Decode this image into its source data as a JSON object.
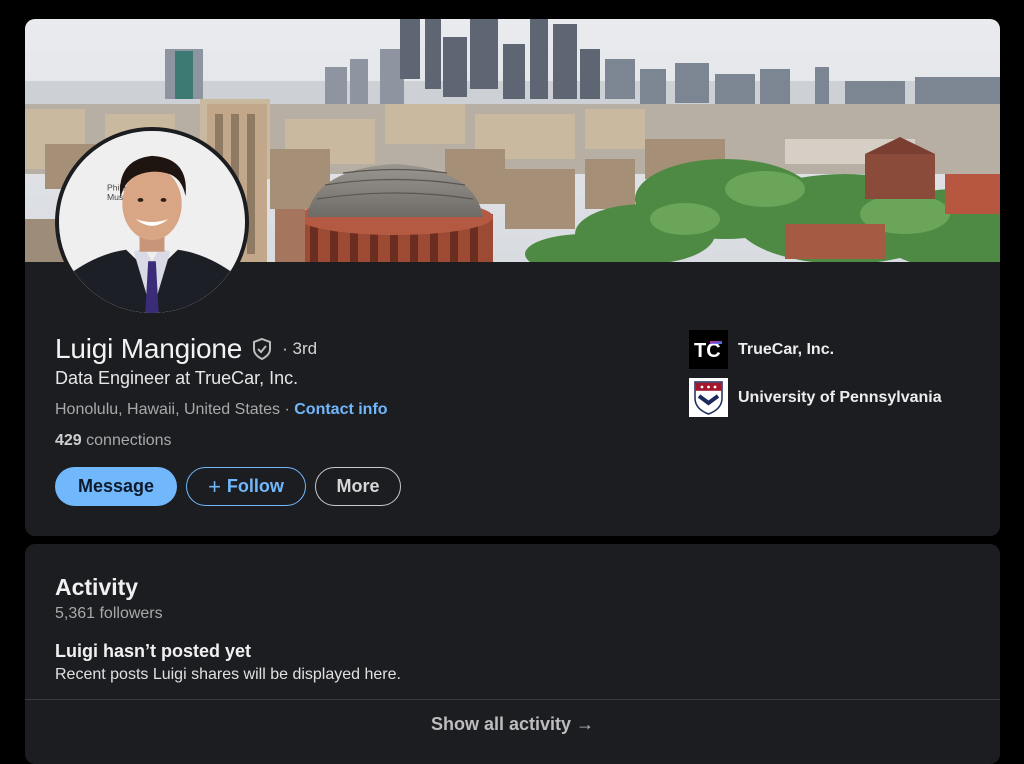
{
  "profile": {
    "name": "Luigi Mangione",
    "degree": "· 3rd",
    "headline": "Data Engineer at TrueCar, Inc.",
    "location": "Honolulu, Hawaii, United States",
    "separator": " · ",
    "contact_label": "Contact info",
    "connections_count": "429",
    "connections_label": " connections",
    "avatar_sign_text": "Philad\nMuse"
  },
  "actions": {
    "message_label": "Message",
    "follow_plus": "+",
    "follow_label": "Follow",
    "more_label": "More"
  },
  "organizations": [
    {
      "name": "TrueCar, Inc.",
      "logo_text": "TC",
      "icon": "truecar-logo"
    },
    {
      "name": "University of Pennsylvania",
      "icon": "penn-shield-logo"
    }
  ],
  "activity": {
    "title": "Activity",
    "followers": "5,361 followers",
    "empty_title": "Luigi hasn’t posted yet",
    "empty_description": "Recent posts Luigi shares will be displayed here.",
    "show_all_label": "Show all activity →"
  },
  "colors": {
    "background": "#000000",
    "card": "#1c1d21",
    "link_blue": "#71b7fb",
    "text_primary": "#f3f3f3",
    "text_secondary": "#a9a9a9"
  },
  "icons": {
    "verify": "shield-check-icon",
    "arrow": "arrow-right-icon"
  }
}
